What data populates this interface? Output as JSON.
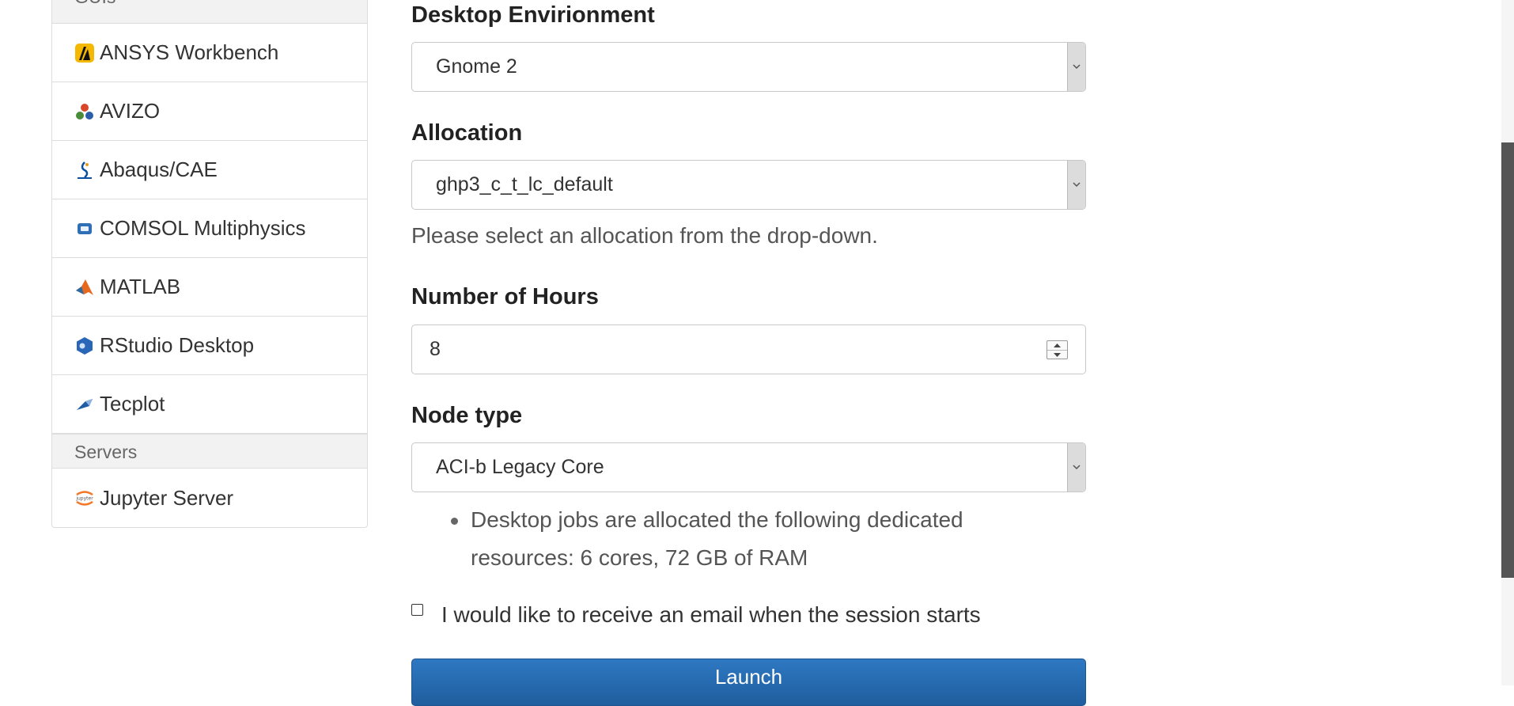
{
  "sidebar": {
    "gui_header": "GUIs",
    "items": [
      {
        "label": "ANSYS Workbench",
        "icon": "ansys-icon"
      },
      {
        "label": "AVIZO",
        "icon": "avizo-icon"
      },
      {
        "label": "Abaqus/CAE",
        "icon": "abaqus-icon"
      },
      {
        "label": "COMSOL Multiphysics",
        "icon": "comsol-icon"
      },
      {
        "label": "MATLAB",
        "icon": "matlab-icon"
      },
      {
        "label": "RStudio Desktop",
        "icon": "rstudio-icon"
      },
      {
        "label": "Tecplot",
        "icon": "tecplot-icon"
      }
    ],
    "servers_header": "Servers",
    "servers": [
      {
        "label": "Jupyter Server",
        "icon": "jupyter-icon"
      }
    ]
  },
  "form": {
    "desktop": {
      "label": "Desktop Envirionment",
      "value": "Gnome 2"
    },
    "allocation": {
      "label": "Allocation",
      "value": "ghp3_c_t_lc_default",
      "help": "Please select an allocation from the drop-down."
    },
    "hours": {
      "label": "Number of Hours",
      "value": "8"
    },
    "node_type": {
      "label": "Node type",
      "value": "ACI-b Legacy Core",
      "bullet": "Desktop jobs are allocated the following dedicated resources: 6 cores, 72 GB of RAM"
    },
    "email_checkbox": {
      "label": "I would like to receive an email when the session starts",
      "checked": false
    },
    "launch": "Launch"
  },
  "colors": {
    "launch": "#2a6db5",
    "header_bg": "#f2f2f2"
  }
}
